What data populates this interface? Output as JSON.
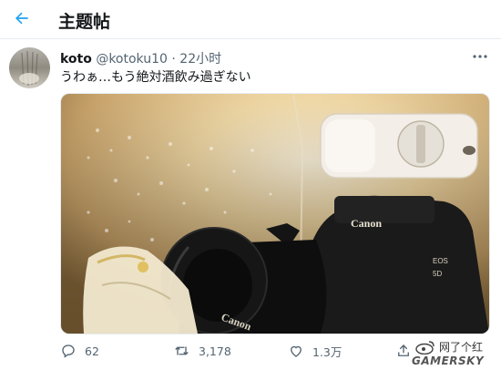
{
  "header": {
    "title": "主题帖",
    "back_icon": "arrow-left-icon"
  },
  "tweet": {
    "display_name": "koto",
    "handle": "@kotoku10",
    "separator": "·",
    "time_ago": "22小时",
    "text": "うわぁ…もう絶対酒飲み過ぎない",
    "image_text": {
      "camera_brand": "Canon",
      "model": "EOS",
      "model_number": "5D",
      "lens_brand": "Canon"
    }
  },
  "actions": {
    "reply_count": "62",
    "retweet_count": "3,178",
    "like_count": "1.3万",
    "icons": [
      "reply-icon",
      "retweet-icon",
      "like-icon",
      "share-icon"
    ]
  },
  "watermark": {
    "line1": "网了个红",
    "line2": "GAMERSKY"
  },
  "colors": {
    "accent": "#1da1f2",
    "text": "#14171a",
    "muted": "#536471",
    "border": "#e6ecf0"
  }
}
